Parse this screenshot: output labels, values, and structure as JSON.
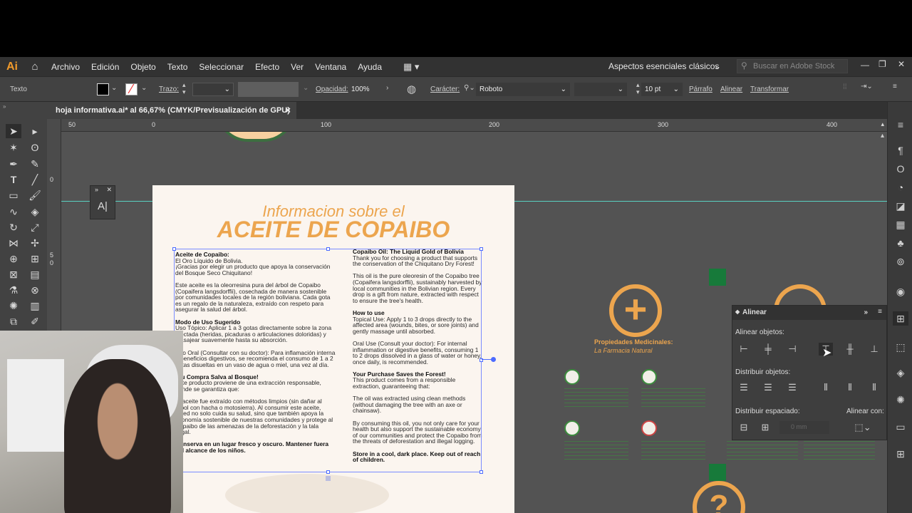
{
  "app": {
    "logo": "Ai"
  },
  "menu": [
    "Archivo",
    "Edición",
    "Objeto",
    "Texto",
    "Seleccionar",
    "Efecto",
    "Ver",
    "Ventana",
    "Ayuda"
  ],
  "workspace": "Aspectos esenciales clásicos",
  "stock_search": {
    "placeholder": "Buscar en Adobe Stock"
  },
  "control_bar": {
    "selection_type": "Texto",
    "stroke_label": "Trazo:",
    "opacity_label": "Opacidad:",
    "opacity_value": "100%",
    "character_label": "Carácter:",
    "font_name": "Roboto",
    "font_size": "10 pt",
    "paragraph_label": "Párrafo",
    "align_label": "Alinear",
    "transform_label": "Transformar"
  },
  "document_tab": {
    "title": "hoja informativa.ai* al 66,67% (CMYK/Previsualización de GPU)",
    "close": "×"
  },
  "ruler_h": [
    "50",
    "0",
    "100",
    "200",
    "300",
    "400"
  ],
  "ruler_v": [
    "0",
    "5",
    "0"
  ],
  "artboard": {
    "title_line1": "Informacion sobre el",
    "title_line2": "ACEITE DE COPAIBO",
    "left_column": [
      "Aceite de Copaibo:",
      "El Oro Líquido de Bolivia.",
      "¡Gracias por elegir un producto que apoya la conservación del Bosque Seco Chiquitano!",
      "Este aceite es la oleorresina pura del árbol de Copaibo (Copaifera langsdorffii), cosechada de manera sostenible por comunidades locales de la región boliviana. Cada gota es un regalo de la naturaleza, extraído con respeto para asegurar la salud del árbol.",
      "Modo de Uso Sugerido",
      "Uso Tópico: Aplicar 1 a 3 gotas directamente sobre la zona afectada (heridas, picaduras o articulaciones doloridas) y masajear suavemente hasta su absorción.",
      "Uso Oral (Consultar con su doctor): Para inflamación interna o beneficios digestivos, se recomienda el consumo de 1 a 2 gotas disueltas en un vaso de agua o miel, una vez al día.",
      "¡Su Compra Salva al Bosque!",
      "Este producto proviene de una extracción responsable, donde se garantiza que:",
      "El aceite fue extraído con métodos limpios (sin dañar al árbol con hacha o motosierra). Al consumir este aceite, usted no solo cuida su salud, sino que también apoya la economía sostenible de nuestras comunidades y protege al Copaibo de las amenazas de la deforestación y la tala ilegal.",
      "Conserva en un lugar fresco y oscuro. Mantener fuera del alcance de los niños."
    ],
    "right_column": [
      "Copaibo Oil: The Liquid Gold of Bolivia",
      "Thank you for choosing a product that supports the conservation of the Chiquitano Dry Forest!",
      "This oil is the pure oleoresin of the Copaibo tree (Copaifera langsdorffii), sustainably harvested by local communities in the Bolivian region. Every drop is a gift from nature, extracted with respect to ensure the tree's health.",
      "How to use",
      "Topical Use: Apply 1 to 3 drops directly to the affected area (wounds, bites, or sore joints) and gently massage until absorbed.",
      "Oral Use (Consult your doctor): For internal inflammation or digestive benefits, consuming 1 to 2 drops dissolved in a glass of water or honey, once daily, is recommended.",
      "Your Purchase Saves the Forest!",
      "This product comes from a responsible extraction, guaranteeing that:",
      "The oil was extracted using clean methods (without damaging the tree with an axe or chainsaw).",
      "By consuming this oil, you not only care for your health but also support the sustainable economy of our communities and protect the Copaibo from the threats of deforestation and illegal logging.",
      "Store in a cool, dark place. Keep out of reach of children."
    ]
  },
  "side_artwork": {
    "heading": "Propiedades Medicinales:",
    "subheading": "La Farmacia Natural",
    "question_mark": "?",
    "plus": "+"
  },
  "align_panel": {
    "title": "Alinear",
    "align_objects": "Alinear objetos:",
    "distribute_objects": "Distribuir objetos:",
    "distribute_spacing": "Distribuir espaciado:",
    "align_to": "Alinear con:",
    "spacing_value": "0 mm"
  },
  "colors": {
    "accent_orange": "#eca54e",
    "green": "#3c8d3e",
    "guide_cyan": "#5ad0c0",
    "selection_blue": "#7a8cff"
  }
}
